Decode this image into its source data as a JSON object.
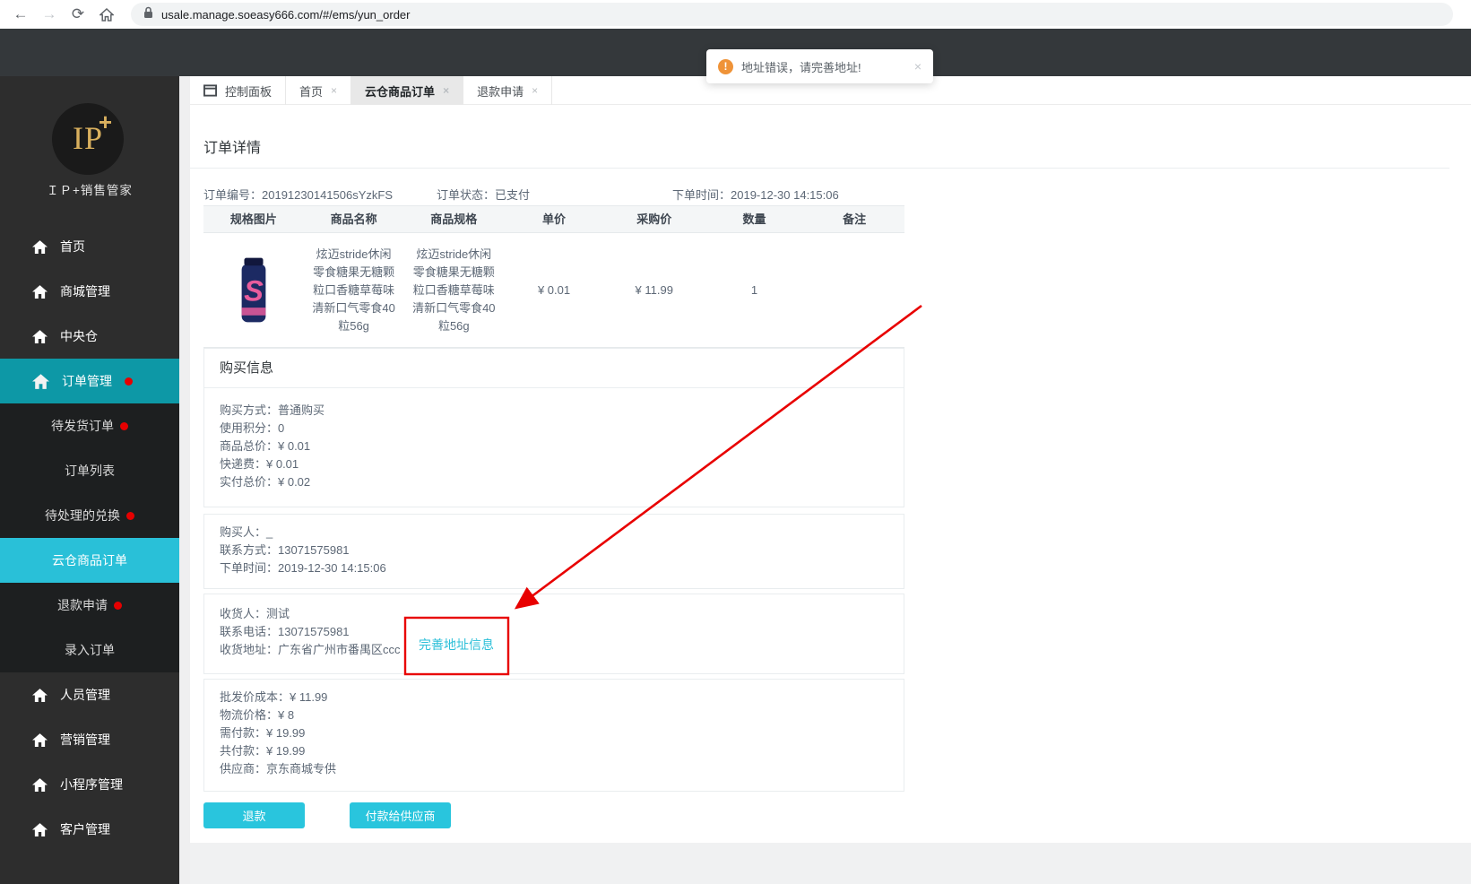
{
  "ui": {
    "close_glyph": "×"
  },
  "icons": {
    "back": "←",
    "forward": "→",
    "refresh": "⟳",
    "warning": "!"
  },
  "browser": {
    "url": "usale.manage.soeasy666.com/#/ems/yun_order"
  },
  "toast": {
    "message": "地址错误，请完善地址!"
  },
  "tabs": {
    "dashboard": "控制面板",
    "items": [
      {
        "label": "首页"
      },
      {
        "label": "云仓商品订单"
      },
      {
        "label": "退款申请"
      }
    ]
  },
  "sidebar": {
    "logo_main": "IP",
    "logo_plus": "+",
    "brand": "ＩＰ+销售管家",
    "items": [
      {
        "label": "首页"
      },
      {
        "label": "商城管理"
      },
      {
        "label": "中央仓"
      },
      {
        "label": "订单管理"
      },
      {
        "label": "待发货订单"
      },
      {
        "label": "订单列表"
      },
      {
        "label": "待处理的兑换"
      },
      {
        "label": "云仓商品订单"
      },
      {
        "label": "退款申请"
      },
      {
        "label": "录入订单"
      },
      {
        "label": "人员管理"
      },
      {
        "label": "营销管理"
      },
      {
        "label": "小程序管理"
      },
      {
        "label": "客户管理"
      }
    ]
  },
  "order": {
    "title": "订单详情",
    "meta": {
      "order_no": "订单编号：20191230141506sYzkFS",
      "status": "订单状态：已支付",
      "time": "下单时间：2019-12-30 14:15:06"
    },
    "table": {
      "headers": [
        "规格图片",
        "商品名称",
        "商品规格",
        "单价",
        "采购价",
        "数量",
        "备注"
      ],
      "row": {
        "image_letter": "S",
        "name": "炫迈stride休闲零食糖果无糖颗粒口香糖草莓味清新口气零食40粒56g",
        "spec": "炫迈stride休闲零食糖果无糖颗粒口香糖草莓味清新口气零食40粒56g",
        "unit_price": "¥ 0.01",
        "purchase_price": "¥ 11.99",
        "quantity": "1",
        "remark": ""
      }
    },
    "purchase_info": {
      "title": "购买信息",
      "lines": [
        "购买方式：普通购买",
        "使用积分：0",
        "商品总价：¥ 0.01",
        "快递费：¥ 0.01",
        "实付总价：¥ 0.02"
      ]
    },
    "buyer": {
      "lines": [
        "购买人：_",
        "联系方式：13071575981",
        "下单时间：2019-12-30 14:15:06"
      ]
    },
    "receiver": {
      "lines": [
        "收货人：测试",
        "联系电话：13071575981",
        "收货地址：广东省广州市番禺区ccc"
      ],
      "link": "完善地址信息"
    },
    "supplier": {
      "lines": [
        "批发价成本：¥ 11.99",
        "物流价格：¥ 8",
        "需付款：¥ 19.99",
        "共付款：¥ 19.99",
        "供应商：京东商城专供"
      ]
    },
    "buttons": {
      "refund": "退款",
      "pay_supplier": "付款给供应商"
    }
  },
  "colors": {
    "accent": "#29c0d8",
    "sidebar_active_parent": "#0d98a6",
    "annotation_red": "#e80000",
    "toast_icon_orange": "#ef9338",
    "notification_dot_red": "#e60000"
  }
}
